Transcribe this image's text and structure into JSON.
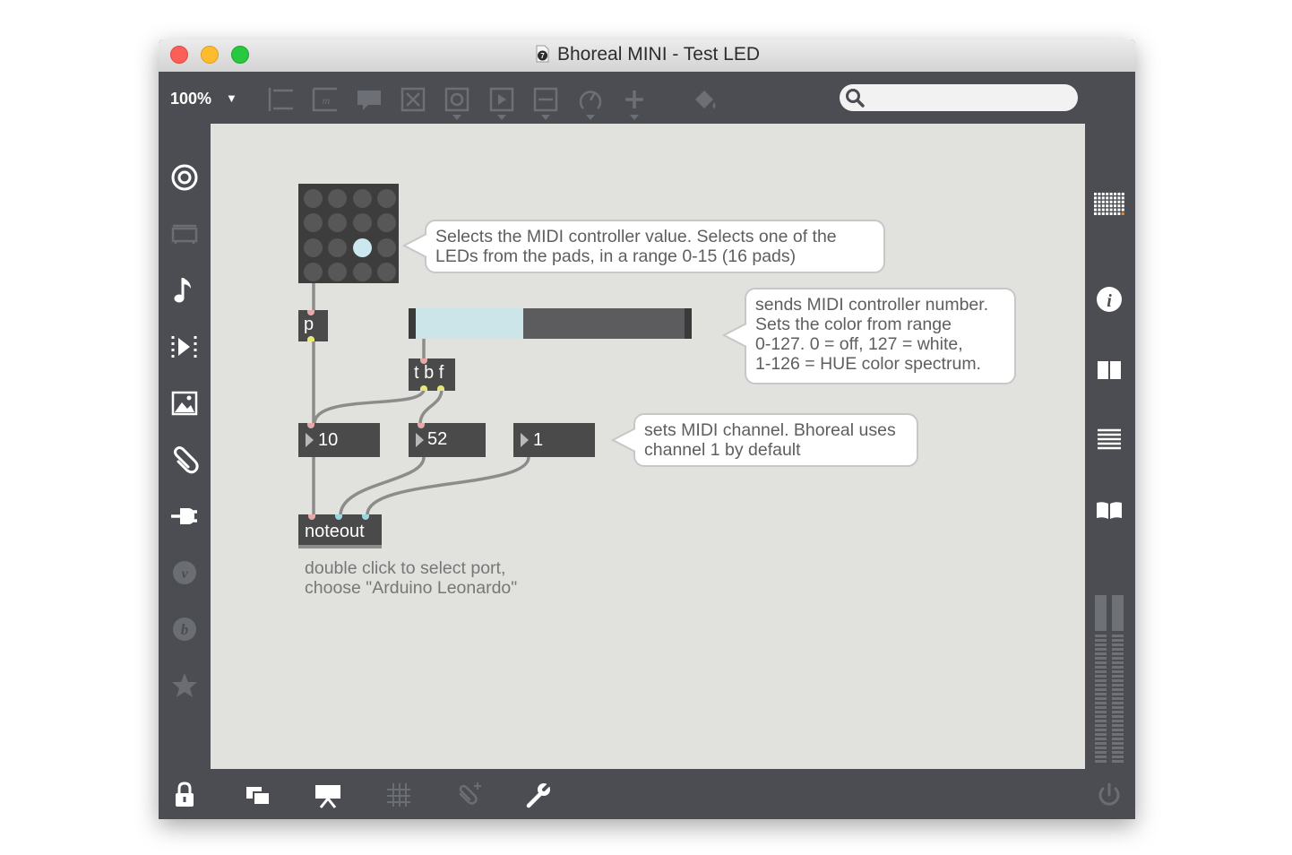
{
  "window": {
    "title": "Bhoreal MINI - Test LED"
  },
  "toolbar": {
    "zoom_level": "100%",
    "icons": [
      "presentation-list-icon",
      "message-box-icon",
      "comment-icon",
      "toggle-x-icon",
      "button-circle-icon",
      "play-box-icon",
      "slider-icon",
      "dial-icon",
      "plus-icon",
      "paint-bucket-icon"
    ],
    "search": {
      "value": "",
      "placeholder": ""
    }
  },
  "left_sidebar": {
    "icons": [
      "target-icon",
      "device-icon",
      "music-note-icon",
      "step-forward-icon",
      "image-icon",
      "paperclip-icon",
      "plug-icon",
      "vimeo-v-icon",
      "b-badge-icon",
      "star-icon"
    ]
  },
  "right_sidebar": {
    "icons": [
      "grid-matrix-icon",
      "info-icon",
      "book-split-icon",
      "list-icon",
      "open-book-icon",
      "level-meter-icon"
    ]
  },
  "bottom_bar": {
    "icons": [
      "lock-icon",
      "windows-icon",
      "presentation-icon",
      "grid-icon",
      "clip-add-icon",
      "wrench-icon",
      "power-icon"
    ]
  },
  "patch": {
    "matrix": {
      "rows": 4,
      "cols": 4,
      "selected_row": 3,
      "selected_col": 3,
      "led_color": "#575757",
      "selected_color": "#cce7ee"
    },
    "p_object": "p",
    "slider": {
      "value": 52,
      "max": 127,
      "fill_color": "#cce5e9",
      "track_color": "#5c5c5e"
    },
    "tbf_object": "t b f",
    "numbers": {
      "note": "10",
      "controller": "52",
      "channel": "1"
    },
    "noteout_object": "noteout",
    "comments": {
      "matrix_line1": "Selects the MIDI controller value. Selects one of the",
      "matrix_line2": "LEDs from the pads, in a range 0-15 (16 pads)",
      "slider_line1": "sends MIDI controller number.",
      "slider_line2": "Sets the color from range",
      "slider_line3": "0-127. 0 = off, 127 = white,",
      "slider_line4": "1-126 = HUE color spectrum.",
      "channel_line1": "sets MIDI channel. Bhoreal uses",
      "channel_line2": "channel 1 by default",
      "port_line1": "double click to select port,",
      "port_line2": "choose \"Arduino Leonardo\""
    }
  }
}
